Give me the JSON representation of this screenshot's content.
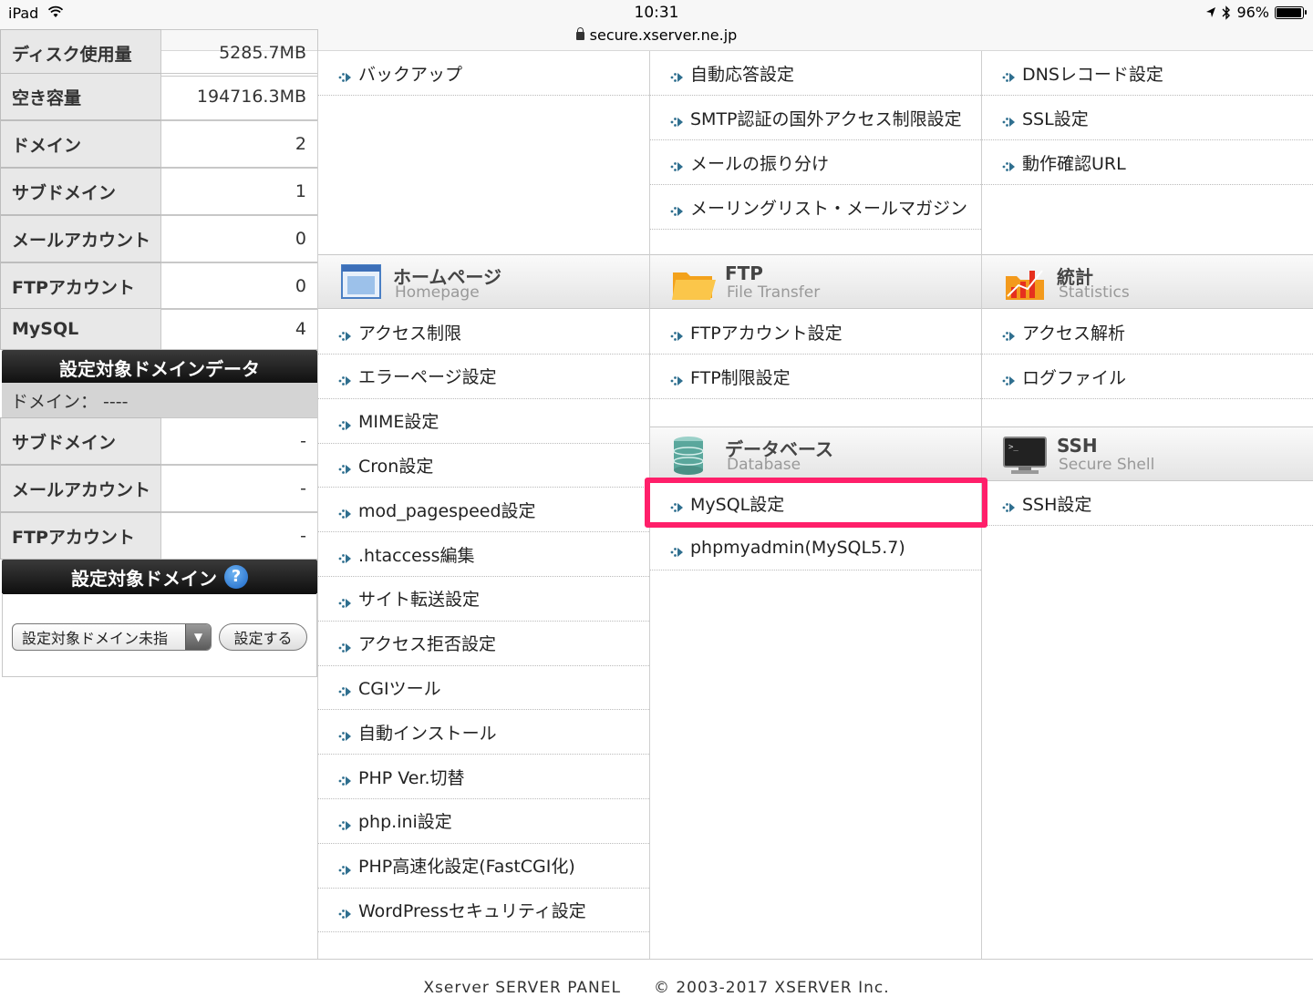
{
  "status_bar": {
    "device": "iPad",
    "time": "10:31",
    "url": "secure.xserver.ne.jp",
    "battery": "96%",
    "battery_level": 0.96
  },
  "sidebar": {
    "stats": [
      {
        "label": "ディスク使用量",
        "value": "5285.7MB"
      },
      {
        "label": "空き容量",
        "value": "194716.3MB"
      },
      {
        "label": "ドメイン",
        "value": "2"
      },
      {
        "label": "サブドメイン",
        "value": "1"
      },
      {
        "label": "メールアカウント",
        "value": "0"
      },
      {
        "label": "FTPアカウント",
        "value": "0"
      },
      {
        "label": "MySQL",
        "value": "4"
      }
    ],
    "domain_data_header": "設定対象ドメインデータ",
    "domain_line": "ドメイン： ----",
    "domain_stats": [
      {
        "label": "サブドメイン",
        "value": "-"
      },
      {
        "label": "メールアカウント",
        "value": "-"
      },
      {
        "label": "FTPアカウント",
        "value": "-"
      }
    ],
    "target_domain_header": "設定対象ドメイン",
    "help_glyph": "?",
    "select_value": "設定対象ドメイン未指",
    "set_button": "設定する"
  },
  "col1": {
    "top_items": [
      "バックアップ"
    ],
    "section": {
      "title": "ホームページ",
      "subtitle": "Homepage",
      "icon": "homepage-window-icon"
    },
    "items": [
      "アクセス制限",
      "エラーページ設定",
      "MIME設定",
      "Cron設定",
      "mod_pagespeed設定",
      ".htaccess編集",
      "サイト転送設定",
      "アクセス拒否設定",
      "CGIツール",
      "自動インストール",
      "PHP Ver.切替",
      "php.ini設定",
      "PHP高速化設定(FastCGI化)",
      "WordPressセキュリティ設定"
    ]
  },
  "col2": {
    "top_items": [
      "自動応答設定",
      "SMTP認証の国外アクセス制限設定",
      "メールの振り分け",
      "メーリングリスト・メールマガジン"
    ],
    "ftp_section": {
      "title": "FTP",
      "subtitle": "File Transfer",
      "icon": "folder-icon"
    },
    "ftp_items": [
      "FTPアカウント設定",
      "FTP制限設定"
    ],
    "db_section": {
      "title": "データベース",
      "subtitle": "Database",
      "icon": "database-icon"
    },
    "db_items": [
      "MySQL設定",
      "phpmyadmin(MySQL5.7)"
    ]
  },
  "col3": {
    "top_items": [
      "DNSレコード設定",
      "SSL設定",
      "動作確認URL"
    ],
    "stats_section": {
      "title": "統計",
      "subtitle": "Statistics",
      "icon": "statistics-icon"
    },
    "stats_items": [
      "アクセス解析",
      "ログファイル"
    ],
    "ssh_section": {
      "title": "SSH",
      "subtitle": "Secure Shell",
      "icon": "terminal-icon"
    },
    "ssh_items": [
      "SSH設定"
    ]
  },
  "highlight_color": "#ff1f6a",
  "footer": "Xserver SERVER PANEL　　© 2003-2017 XSERVER Inc."
}
